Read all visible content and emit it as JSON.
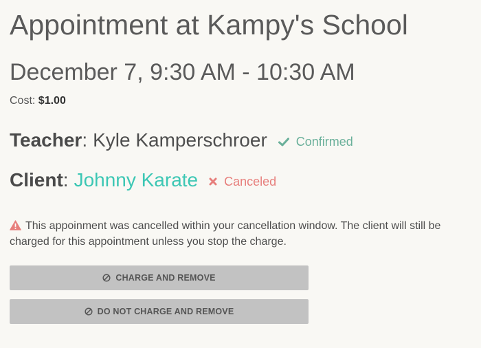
{
  "appointment": {
    "title": "Appointment at Kampy's School",
    "datetime": "December 7, 9:30 AM - 10:30 AM",
    "cost_label": "Cost: ",
    "cost_value": "$1.00"
  },
  "teacher": {
    "role_label": "Teacher",
    "separator": ":",
    "name": "Kyle Kamperschroer",
    "status": "Confirmed",
    "status_icon": "check-icon"
  },
  "client": {
    "role_label": "Client",
    "separator": ":",
    "name": "Johnny Karate",
    "status": "Canceled",
    "status_icon": "x-icon"
  },
  "warning": {
    "icon": "warning-triangle-icon",
    "text": "This appoinment was cancelled within your cancellation window. The client will still be charged for this appointment unless you stop the charge."
  },
  "actions": {
    "charge_remove": "CHARGE AND REMOVE",
    "no_charge_remove": "DO NOT CHARGE AND REMOVE",
    "icon": "block-icon"
  },
  "colors": {
    "background": "#f9f8f4",
    "confirmed": "#6ab09a",
    "canceled": "#e77f7c",
    "client_link": "#3cc7b4",
    "warning_icon": "#e77f7c",
    "button_bg": "#c2c2c2"
  }
}
